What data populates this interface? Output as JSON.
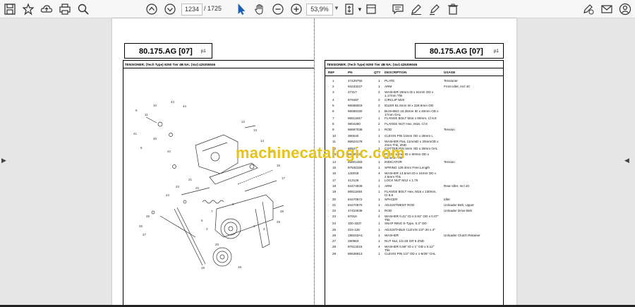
{
  "toolbar": {
    "page_current": "1234",
    "page_total": "/  1725",
    "zoom": "53,9%"
  },
  "document": {
    "code": "80.175.AG [07]",
    "page_no": "p1",
    "subtitle": "TENSIONER; (Tech Type) 9250 Tier 4B NA; (Var) 425306046",
    "columns": [
      "REF",
      "PN",
      "QTY",
      "DESCRIPTION",
      "USAGE"
    ],
    "rows": [
      {
        "ref": "1",
        "pn": "47429750",
        "qty": "1",
        "desc": "PLATE",
        "desc2": "",
        "usage": "Tensioner"
      },
      {
        "ref": "2",
        "pn": "94233227",
        "qty": "1",
        "desc": "ARM",
        "desc2": "",
        "usage": "Front Idler, Incl 40"
      },
      {
        "ref": "3",
        "pn": "27317",
        "qty": "2",
        "desc": "WASHER 26mm ID x 51mm OD x",
        "desc2": "1.17mm Thk",
        "usage": ""
      },
      {
        "ref": "4",
        "pn": "979497",
        "qty": "2",
        "desc": "CIRCLIP M20",
        "desc2": "",
        "usage": ""
      },
      {
        "ref": "5",
        "pn": "86588003",
        "qty": "2",
        "desc": "IDLER 81.6mm W x 228.6mm OD",
        "desc2": "",
        "usage": ""
      },
      {
        "ref": "6",
        "pn": "86588190",
        "qty": "1",
        "desc": "BUSHING 16.25mm ID x 40mm OD x",
        "desc2": "17mm OAL",
        "usage": ""
      },
      {
        "ref": "7",
        "pn": "86511847",
        "qty": "1",
        "desc": "FLANGE BOLT M16 x 90mm, Cl 8.8",
        "desc2": "",
        "usage": ""
      },
      {
        "ref": "8",
        "pn": "9804280",
        "qty": "2",
        "desc": "FLANGE NUT Hex, M16, Cl 8",
        "desc2": "",
        "usage": ""
      },
      {
        "ref": "9",
        "pn": "86697038",
        "qty": "1",
        "desc": "ROD",
        "desc2": "",
        "usage": "Tension"
      },
      {
        "ref": "10",
        "pn": "380040",
        "qty": "1",
        "desc": "CLEVIS PIN 10mm OD x 28mm L",
        "desc2": "",
        "usage": ""
      },
      {
        "ref": "11",
        "pn": "86624178",
        "qty": "1",
        "desc": "WASHER Flat, 11mmID x 20mmOD x",
        "desc2": "2mm Thk, ZND",
        "usage": ""
      },
      {
        "ref": "12",
        "pn": "86547",
        "qty": "1",
        "desc": "COTTER PIN 3mm OD x 30mm OAL",
        "desc2": "",
        "usage": ""
      },
      {
        "ref": "13",
        "pn": "86590521",
        "qty": "1",
        "desc": "PIVOT 13mm ID x 60mm OD x",
        "desc2": "26.4mm Thk",
        "usage": ""
      },
      {
        "ref": "14",
        "pn": "86601493",
        "qty": "1",
        "desc": "INDICATOR",
        "desc2": "",
        "usage": "Tension"
      },
      {
        "ref": "15",
        "pn": "87540166",
        "qty": "1",
        "desc": "SPRING 129.3mm Free Length",
        "desc2": "",
        "usage": ""
      },
      {
        "ref": "16",
        "pn": "140018",
        "qty": "4",
        "desc": "WASHER 13.5mm ID x 24mm OD x",
        "desc2": "2.5mm Thk",
        "usage": ""
      },
      {
        "ref": "17",
        "pn": "412126",
        "qty": "1",
        "desc": "LOCK NUT M12 x 1.75",
        "desc2": "",
        "usage": ""
      },
      {
        "ref": "18",
        "pn": "84474939",
        "qty": "1",
        "desc": "ARM",
        "desc2": "",
        "usage": "Rear Idler, Incl 40"
      },
      {
        "ref": "19",
        "pn": "86511848",
        "qty": "1",
        "desc": "FLANGE BOLT Hex, M16 x 130mm,",
        "desc2": "Cl 8.8",
        "usage": ""
      },
      {
        "ref": "20",
        "pn": "84470572",
        "qty": "1",
        "desc": "SPACER",
        "desc2": "",
        "usage": "Idler"
      },
      {
        "ref": "21",
        "pn": "84470570",
        "qty": "1",
        "desc": "ADJUSTMENT ROD",
        "desc2": "",
        "usage": "Unloader Belt, Upper"
      },
      {
        "ref": "22",
        "pn": "47410038",
        "qty": "1",
        "desc": "ROD",
        "desc2": "",
        "usage": "Unloader Drive Belt"
      },
      {
        "ref": "23",
        "pn": "87016",
        "qty": "4",
        "desc": "WASHER 0.41\" ID x 0.81\" OD x 0.07\"",
        "desc2": "Thk",
        "usage": ""
      },
      {
        "ref": "24",
        "pn": "100-3337",
        "qty": "1",
        "desc": "SNAP RING E-Type, 0.3\" OD",
        "desc2": "",
        "usage": ""
      },
      {
        "ref": "25",
        "pn": "215-126",
        "qty": "1",
        "desc": "ADJUSTABLE CLEVIS 1/2\"-20 x 3\"",
        "desc2": "",
        "usage": ""
      },
      {
        "ref": "26",
        "pn": "198153A1",
        "qty": "1",
        "desc": "WASHER",
        "desc2": "",
        "usage": "Unloader Clutch Retainer"
      },
      {
        "ref": "27",
        "pn": "280963",
        "qty": "1",
        "desc": "NUT Nut, 1/2-20 GR 5 ZND",
        "desc2": "",
        "usage": ""
      },
      {
        "ref": "28",
        "pn": "87613215",
        "qty": "4",
        "desc": "WASHER 0.66\" ID x 1\" OD x 0.12\"",
        "desc2": "Thk",
        "usage": ""
      },
      {
        "ref": "29",
        "pn": "86636813",
        "qty": "1",
        "desc": "CLEVIS PIN 1/2\" OD x 1-9/25\" OAL",
        "desc2": "",
        "usage": ""
      }
    ]
  },
  "watermark": "machinecatalogic.com",
  "diagram_callouts": [
    "9",
    "11",
    "10",
    "43",
    "44",
    "45",
    "41",
    "40",
    "5",
    "31",
    "42",
    "12",
    "13",
    "14",
    "15",
    "16",
    "17",
    "40",
    "21",
    "23",
    "22",
    "24",
    "8",
    "7",
    "6",
    "2",
    "3",
    "4",
    "25",
    "26",
    "27",
    "28",
    "29",
    "19",
    "18",
    "20"
  ]
}
